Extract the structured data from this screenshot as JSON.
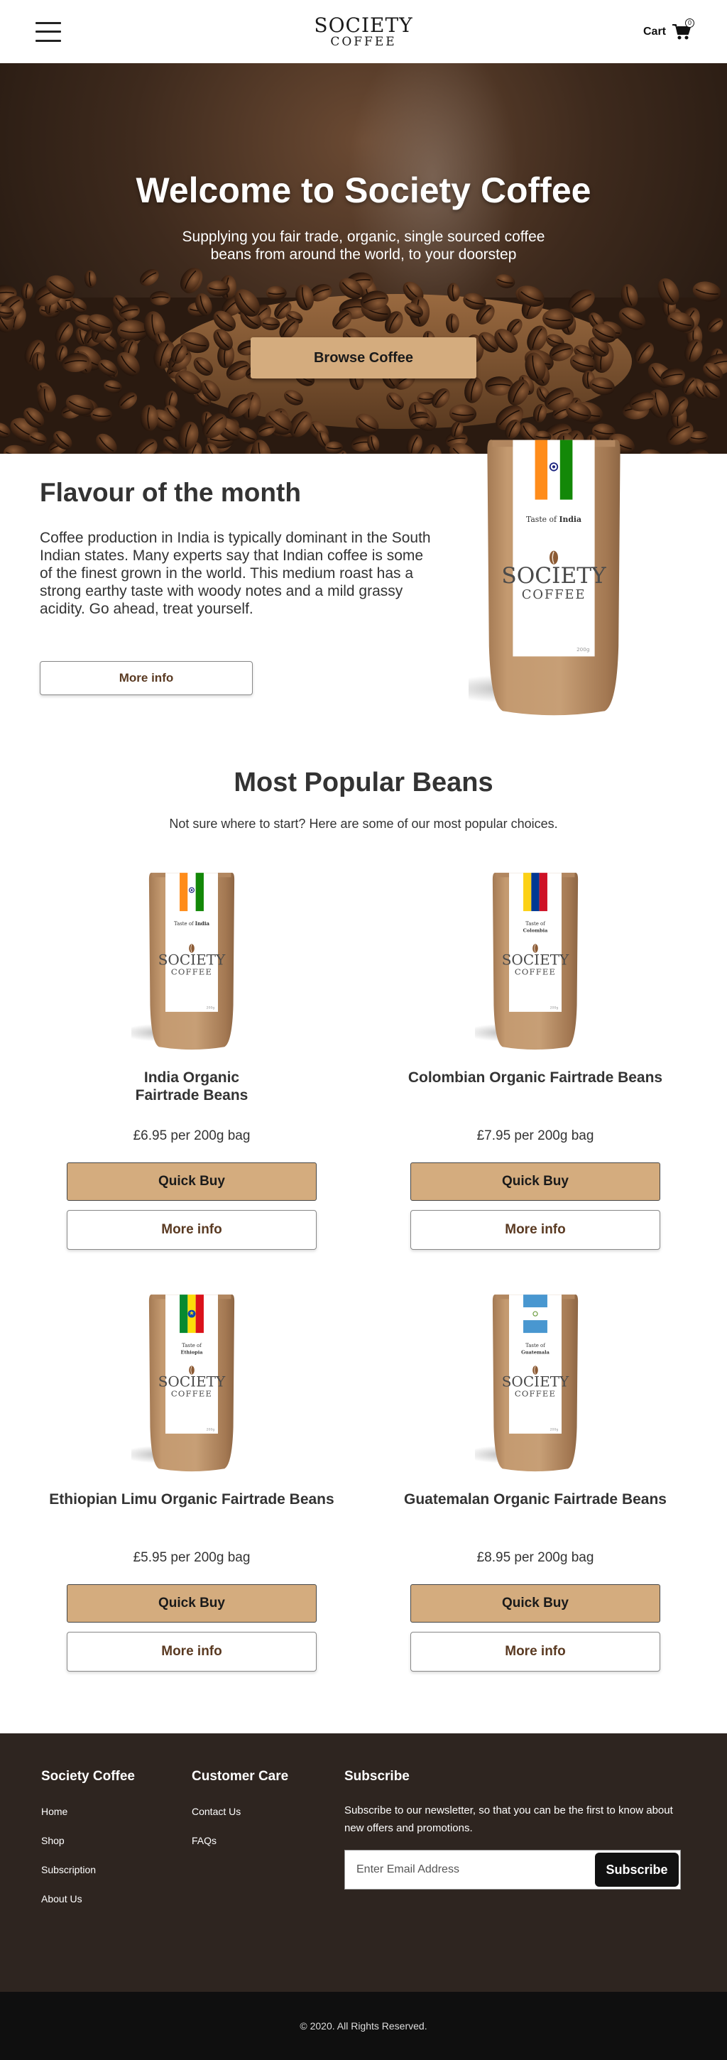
{
  "header": {
    "logo_line1": "SOCIETY",
    "logo_line2": "COFFEE",
    "cart_label": "Cart",
    "cart_count": "0"
  },
  "hero": {
    "title": "Welcome to Society Coffee",
    "subtitle": "Supplying you fair trade, organic, single sourced coffee beans from around the world, to your doorstep",
    "button": "Browse Coffee"
  },
  "flavour": {
    "title": "Flavour of the month",
    "description": "Coffee production in India is typically dominant in the South Indian states. Many experts say that Indian coffee is some of the finest grown in the world. This medium roast has a strong earthy taste with woody notes and a mild grassy acidity. Go ahead, treat yourself.",
    "button": "More info",
    "bag": {
      "taste_label": "Taste of",
      "country": "India",
      "brand1": "SOCIETY",
      "brand2": "COFFEE",
      "weight": "200g"
    }
  },
  "popular": {
    "title": "Most Popular Beans",
    "subtitle": "Not sure where to start? Here are some of our most popular choices.",
    "quick_buy_label": "Quick Buy",
    "more_info_label": "More info",
    "products": [
      {
        "name": "India Organic Fairtrade Beans",
        "price": "£6.95 per 200g bag",
        "country": "India",
        "taste_label": "Taste of",
        "brand1": "SOCIETY",
        "brand2": "COFFEE",
        "weight": "200g"
      },
      {
        "name": "Colombian Organic Fairtrade Beans",
        "price": "£7.95 per 200g bag",
        "country": "Colombia",
        "taste_label": "Taste of",
        "brand1": "SOCIETY",
        "brand2": "COFFEE",
        "weight": "200g"
      },
      {
        "name": "Ethiopian Limu Organic Fairtrade Beans",
        "price": "£5.95 per 200g bag",
        "country": "Ethiopia",
        "taste_label": "Taste of",
        "brand1": "SOCIETY",
        "brand2": "COFFEE",
        "weight": "200g"
      },
      {
        "name": "Guatemalan Organic Fairtrade Beans",
        "price": "£8.95 per 200g bag",
        "country": "Guatemala",
        "taste_label": "Taste of",
        "brand1": "SOCIETY",
        "brand2": "COFFEE",
        "weight": "200g"
      }
    ]
  },
  "footer": {
    "col1_title": "Society Coffee",
    "col1_links": [
      "Home",
      "Shop",
      "Subscription",
      "About Us"
    ],
    "col2_title": "Customer Care",
    "col2_links": [
      "Contact Us",
      "FAQs"
    ],
    "col3_title": "Subscribe",
    "col3_text": "Subscribe to our newsletter, so that you can be the first to know about new offers and promotions.",
    "email_placeholder": "Enter Email Address",
    "subscribe_button": "Subscribe",
    "copyright": "© 2020. All Rights Reserved."
  },
  "colors": {
    "accent": "#d4ac7e",
    "footer_bg": "#2e2520",
    "copyright_bg": "#0f0f0f",
    "link_text": "#5a3a22"
  },
  "icons": [
    "hamburger-menu-icon",
    "cart-icon"
  ]
}
